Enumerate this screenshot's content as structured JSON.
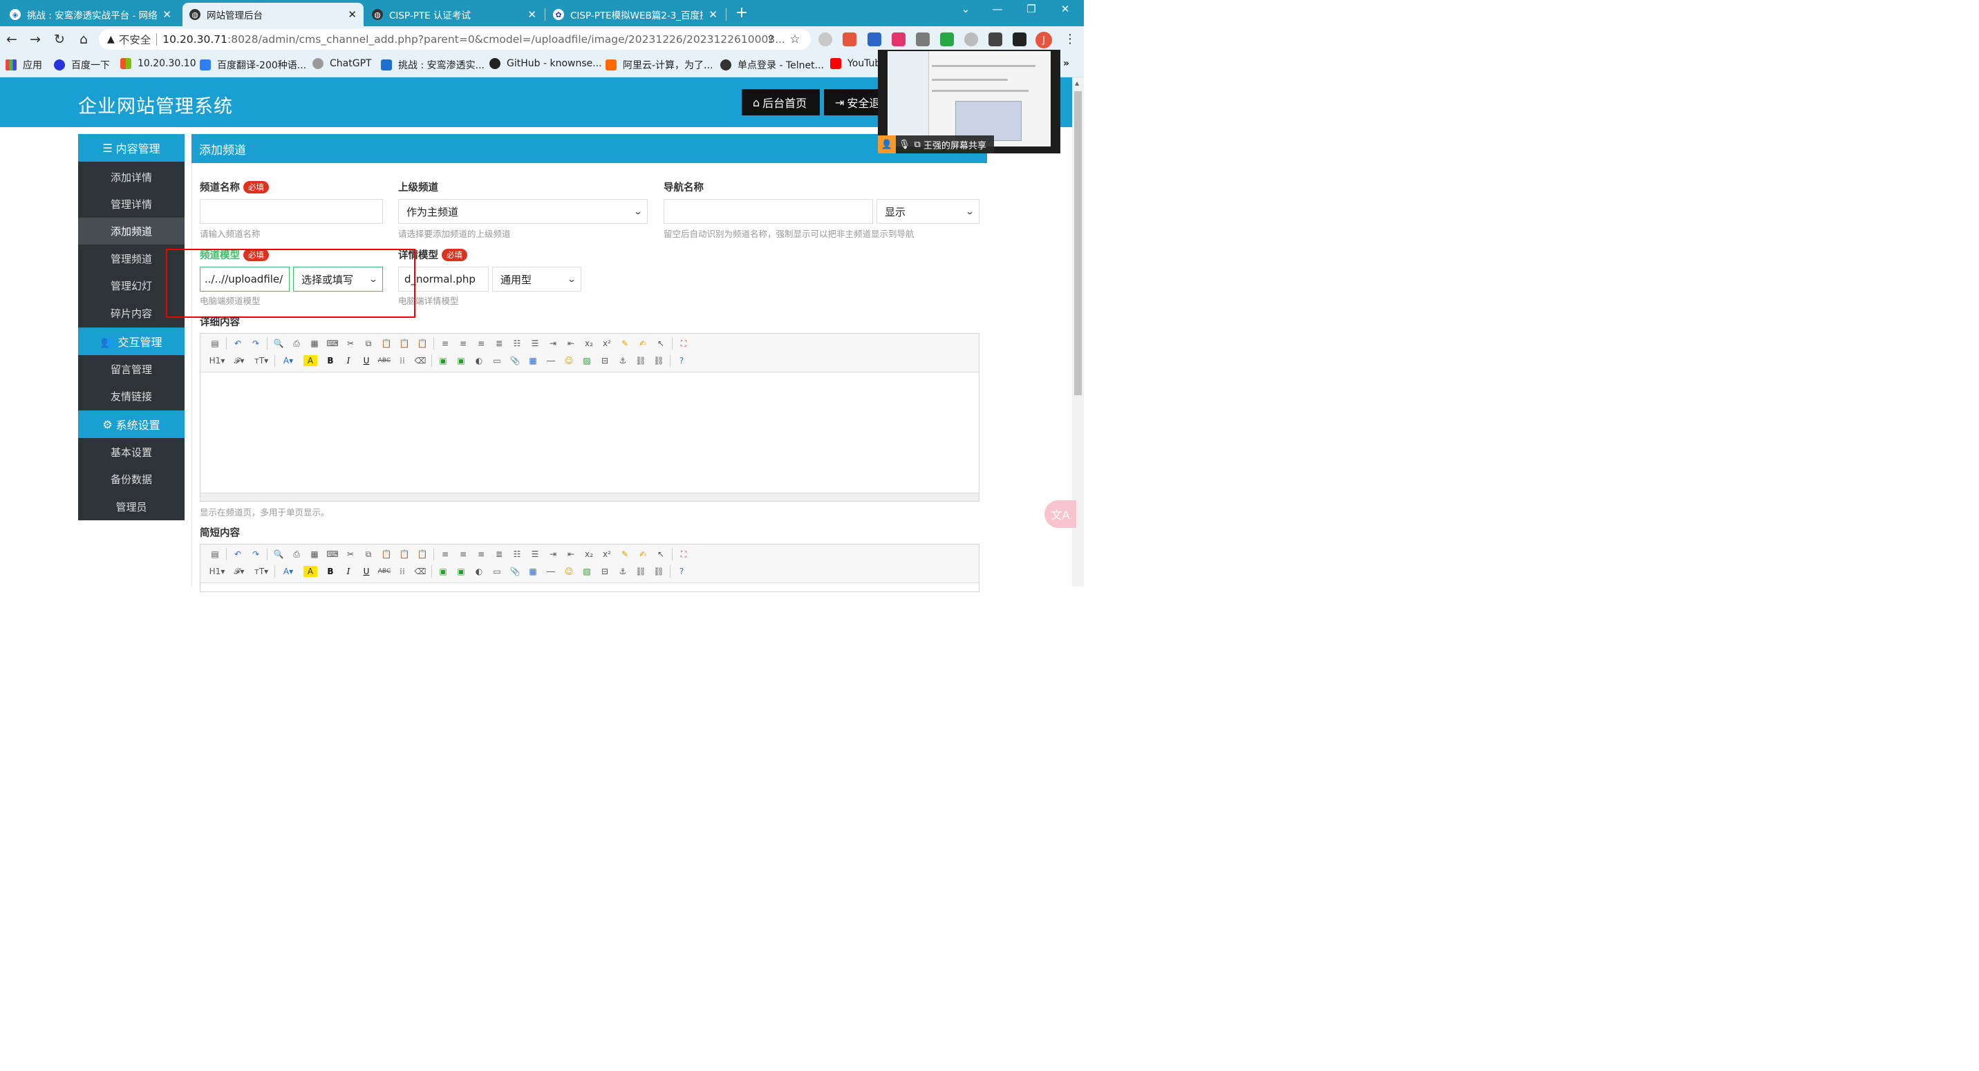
{
  "browser": {
    "tabs": [
      {
        "label": "挑战 : 安鸾渗透实战平台 - 网络安",
        "icon": "shield-icon"
      },
      {
        "label": "网站管理后台",
        "icon": "globe-icon"
      },
      {
        "label": "CISP-PTE 认证考试",
        "icon": "globe-icon"
      },
      {
        "label": "CISP-PTE模拟WEB篇2-3_百度搜",
        "icon": "baidu-paw-icon"
      }
    ],
    "address": {
      "security_label": "不安全",
      "url_host": "10.20.30.71",
      "url_rest": ":8028/admin/cms_channel_add.php?parent=0&cmodel=/uploadfile/image/20231226/2023122610003..."
    },
    "profile_initial": "J",
    "bookmarks": [
      {
        "label": "应用",
        "icon": "apps-grid-icon"
      },
      {
        "label": "百度一下",
        "icon": "baidu-paw-icon"
      },
      {
        "label": "10.20.30.10",
        "icon": "windows-logo-icon"
      },
      {
        "label": "百度翻译-200种语...",
        "icon": "translate-icon"
      },
      {
        "label": "ChatGPT",
        "icon": "chatgpt-icon"
      },
      {
        "label": "挑战 : 安鸾渗透实...",
        "icon": "shield-icon"
      },
      {
        "label": "GitHub - knownse...",
        "icon": "github-icon"
      },
      {
        "label": "阿里云-计算，为了...",
        "icon": "aliyun-icon"
      },
      {
        "label": "单点登录 - Telnet...",
        "icon": "telnet-icon"
      },
      {
        "label": "YouTube",
        "icon": "youtube-icon"
      }
    ]
  },
  "site": {
    "title": "企业网站管理系统",
    "home_button": "后台首页",
    "logout_button": "安全退出"
  },
  "sidebar": {
    "sections": [
      {
        "title": "内容管理",
        "icon": "list-icon",
        "items": [
          "添加详情",
          "管理详情",
          "添加频道",
          "管理频道",
          "管理幻灯",
          "碎片内容"
        ]
      },
      {
        "title": "交互管理",
        "icon": "users-icon",
        "items": [
          "留言管理",
          "友情链接"
        ]
      },
      {
        "title": "系统设置",
        "icon": "gear-icon",
        "items": [
          "基本设置",
          "备份数据",
          "管理员"
        ]
      }
    ],
    "active_item": "添加频道"
  },
  "form": {
    "heading": "添加频道",
    "required_badge": "必填",
    "channel_name": {
      "label": "频道名称",
      "value": "",
      "hint": "请输入频道名称"
    },
    "parent_channel": {
      "label": "上级频道",
      "value": "作为主频道",
      "hint": "请选择要添加频道的上级频道"
    },
    "nav_name": {
      "label": "导航名称",
      "value": "",
      "display_select": "显示",
      "hint": "留空后自动识别为频道名称，强制显示可以把非主频道显示到导航"
    },
    "channel_model": {
      "label": "频道模型",
      "value": "../..//uploadfile/",
      "select": "选择或填写",
      "hint": "电脑端频道模型"
    },
    "detail_model": {
      "label": "详情模型",
      "value": "d_normal.php",
      "select": "通用型",
      "hint": "电脑端详情模型"
    },
    "detail_content": {
      "label": "详细内容",
      "hint": "显示在频道页，多用于单页显示。"
    },
    "short_content": {
      "label": "简短内容"
    }
  },
  "screen_share": {
    "label": "王强的屏幕共享"
  },
  "colors": {
    "accent": "#1a9fd3",
    "sidebar": "#2e3338",
    "required": "#e0311f",
    "tabbar": "#1f97bd",
    "highlight_box": "#ee0000"
  }
}
